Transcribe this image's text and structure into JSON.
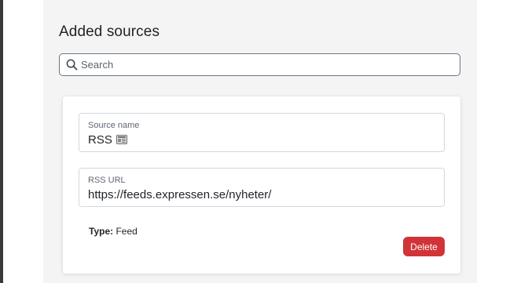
{
  "section": {
    "title": "Added sources"
  },
  "search": {
    "placeholder": "Search",
    "value": ""
  },
  "source_card": {
    "source_name": {
      "label": "Source name",
      "value": "RSS",
      "icon": "newspaper-icon"
    },
    "rss_url": {
      "label": "RSS URL",
      "value": "https://feeds.expressen.se/nyheter/"
    },
    "type": {
      "label": "Type:",
      "value": "Feed"
    },
    "delete_label": "Delete"
  },
  "colors": {
    "panel_background": "#f4f4f5",
    "delete_button": "#d13438",
    "search_border": "#6b7685"
  }
}
